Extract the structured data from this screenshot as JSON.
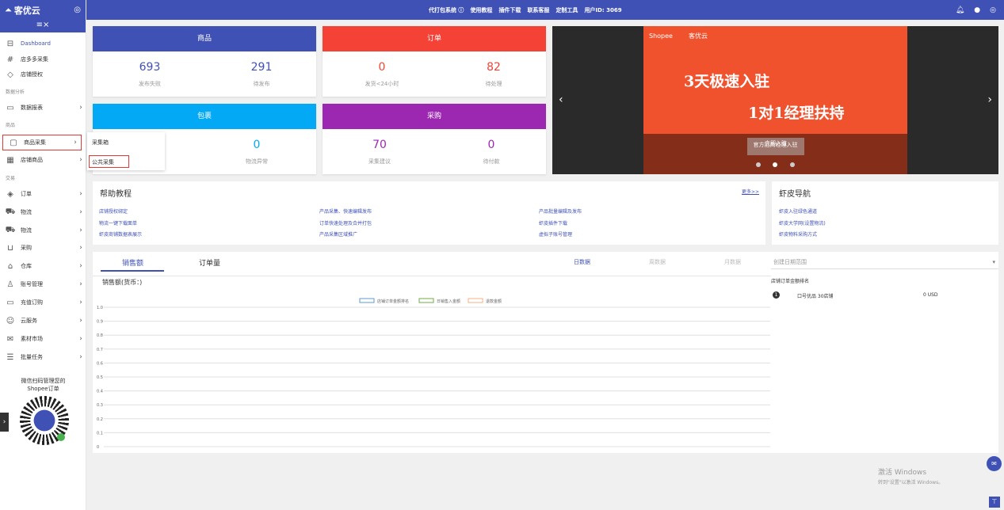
{
  "brand": {
    "name": "客优云",
    "logo_icon": "triangle-logo-icon",
    "lang_icon": "globe-icon"
  },
  "sidebar": {
    "collapse_icon": "menu-collapse-icon",
    "sections": {
      "data": "数据分析",
      "goods": "商品",
      "trade": "交易"
    },
    "items": [
      {
        "label": "Dashboard",
        "icon": "dashboard-icon"
      },
      {
        "label": "店多多采集",
        "icon": "hash-icon"
      },
      {
        "label": "店铺授权",
        "icon": "shield-icon"
      },
      {
        "label": "数据报表",
        "icon": "report-icon"
      },
      {
        "label": "商品采集",
        "icon": "box-icon"
      },
      {
        "label": "店铺商品",
        "icon": "grid-icon"
      },
      {
        "label": "订单",
        "icon": "layers-icon"
      },
      {
        "label": "物流",
        "icon": "truck-icon"
      },
      {
        "label": "物流",
        "icon": "delivery-icon"
      },
      {
        "label": "采购",
        "icon": "cart-icon"
      },
      {
        "label": "仓库",
        "icon": "home-icon"
      },
      {
        "label": "账号管理",
        "icon": "user-icon"
      },
      {
        "label": "充值订购",
        "icon": "folder-icon"
      },
      {
        "label": "云服务",
        "icon": "cloud-user-icon"
      },
      {
        "label": "素材市场",
        "icon": "mail-icon"
      },
      {
        "label": "批量任务",
        "icon": "list-icon"
      }
    ],
    "qr_caption": [
      "微信扫码管理您的",
      "Shopee订单"
    ]
  },
  "flyout": {
    "items": [
      "采集箱",
      "公共采集"
    ]
  },
  "topbar": {
    "links": [
      "代打包系统 ⓘ",
      "使用教程",
      "插件下载",
      "联系客服",
      "定制工具",
      "用户ID: 3069"
    ],
    "icons": [
      "bell-icon",
      "user-icon",
      "globe-icon"
    ]
  },
  "cards": {
    "goods": {
      "title": "商品",
      "color": "#3f51b5",
      "stats": [
        {
          "value": "693",
          "label": "发布失败"
        },
        {
          "value": "291",
          "label": "待发布"
        }
      ]
    },
    "orders": {
      "title": "订单",
      "color": "#f44336",
      "stats": [
        {
          "value": "0",
          "label": "发货<24小时"
        },
        {
          "value": "82",
          "label": "待处理"
        }
      ]
    },
    "packages": {
      "title": "包裹",
      "color": "#03a9f4",
      "stats": [
        {
          "value": "0",
          "label": "物流异常"
        }
      ]
    },
    "purchase": {
      "title": "采购",
      "color": "#9c27b0",
      "stats": [
        {
          "value": "70",
          "label": "采集建议"
        },
        {
          "value": "0",
          "label": "待付款"
        }
      ]
    }
  },
  "banner": {
    "shopee": "Shopee",
    "brand": "客优云",
    "headline1": "3天极速入驻",
    "headline2": "1对1经理扶持",
    "cta": "立即入驻",
    "caption": "官方招商经理入驻",
    "slides": 3,
    "active_slide": 1
  },
  "help": {
    "title": "帮助教程",
    "more": "更多>>",
    "links": [
      "店铺授权绑定",
      "产品采集、快速编辑发布",
      "产品批量编辑及发布",
      "物流一键下载面单",
      "订单快速处理及合并打包",
      "虾皮插件下载",
      "虾皮商铺数据表展示",
      "产品采集区域推广",
      "虚拟子账号管理"
    ]
  },
  "shopee_nav": {
    "title": "虾皮导航",
    "links": [
      "虾皮入驻绿色通道",
      "虾皮大学网(设置物流)",
      "虾皮物料采购方式"
    ]
  },
  "sales": {
    "tabs": [
      "销售额",
      "订单量"
    ],
    "ranges": [
      "日数据",
      "周数据",
      "月数据"
    ],
    "chart_title": "销售额(货币：)",
    "legend": [
      "店铺订单金额排名",
      "日销售入金额",
      "退款金额"
    ],
    "legend_colors": [
      "#5b9bd5",
      "#70ad47",
      "#f4b183"
    ]
  },
  "chart_data": {
    "type": "line",
    "title": "销售额(货币：)",
    "ylim": [
      0,
      1.0
    ],
    "y_ticks": [
      "0",
      "0.1",
      "0.2",
      "0.3",
      "0.4",
      "0.5",
      "0.6",
      "0.7",
      "0.8",
      "0.9",
      "1.0"
    ],
    "series": [
      {
        "name": "店铺订单金额排名",
        "values": []
      },
      {
        "name": "日销售入金额",
        "values": []
      },
      {
        "name": "退款金额",
        "values": []
      }
    ],
    "grid": true,
    "legend_position": "top"
  },
  "rank": {
    "date_placeholder": "创建日期范围",
    "title": "店铺订单金额排名",
    "rows": [
      {
        "rank": "1",
        "name": "口号优品 30店铺",
        "value": "0 USD"
      }
    ]
  },
  "watermark": {
    "line1": "激活 Windows",
    "line2": "转到\"设置\"以激活 Windows。"
  }
}
